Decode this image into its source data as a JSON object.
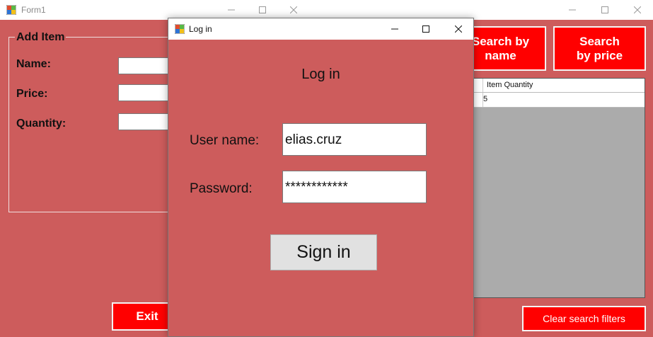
{
  "main_window": {
    "title": "Form1",
    "add_item": {
      "group_title": "Add Item",
      "name_label": "Name:",
      "price_label": "Price:",
      "quantity_label": "Quantity:"
    },
    "buttons": {
      "search_by_name": "Search by name",
      "search_by_price": "Search by price",
      "exit": "Exit",
      "clear_filters": "Clear search filters"
    },
    "grid": {
      "columns": [
        "",
        "Item Quantity"
      ],
      "rows": [
        [
          "",
          "5"
        ]
      ]
    }
  },
  "login_dialog": {
    "title": "Log in",
    "heading": "Log in",
    "username_label": "User name:",
    "username_value": "elias.cruz",
    "password_label": "Password:",
    "password_value": "************",
    "signin_label": "Sign in"
  },
  "icons": {
    "app_icon": "app-icon",
    "minimize": "minimize-icon",
    "maximize": "maximize-icon",
    "close": "close-icon"
  },
  "colors": {
    "form_background": "#cd5c5c",
    "action_button": "#ff0000",
    "grid_background": "#ababab"
  }
}
